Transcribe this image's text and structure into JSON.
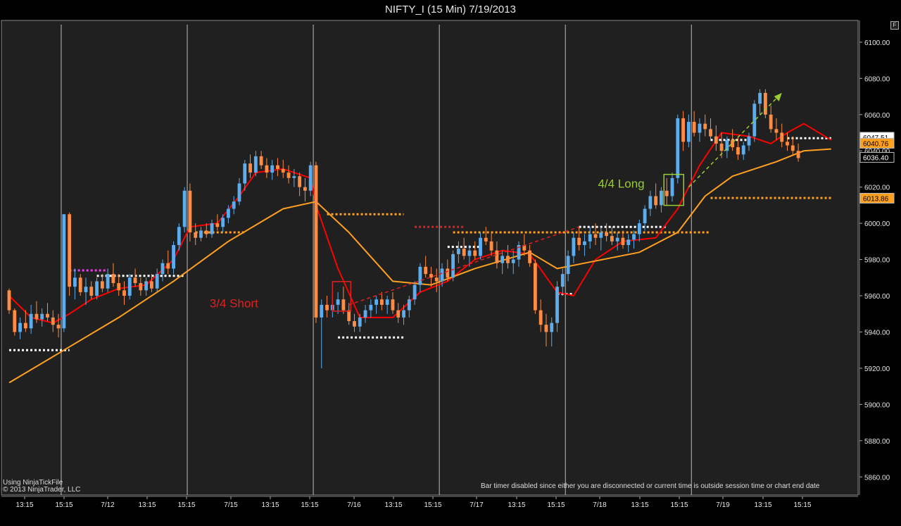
{
  "window": {
    "title": "NIFTY_I (15 Min)  7/19/2013",
    "float_button": "F"
  },
  "footer": {
    "provider": "Using NinjaTickFile",
    "copyright": "© 2013 NinjaTrader, LLC",
    "bar_timer_note": "Bar timer disabled since either you are disconnected or current time is outside session time or chart end date"
  },
  "chart_data": {
    "type": "candlestick",
    "title": "NIFTY_I (15 Min)  7/19/2013",
    "ylim": [
      5850,
      6112
    ],
    "y_ticks": [
      "6100.00",
      "6080.00",
      "6060.00",
      "6040.00",
      "6020.00",
      "6000.00",
      "5980.00",
      "5960.00",
      "5940.00",
      "5920.00",
      "5900.00",
      "5880.00",
      "5860.00"
    ],
    "y_tick_values": [
      6100,
      6080,
      6060,
      6040,
      6020,
      6000,
      5980,
      5960,
      5940,
      5920,
      5900,
      5880,
      5860
    ],
    "x_labels": [
      "13:15",
      "15:15",
      "7/12",
      "13:15",
      "15:15",
      "7/15",
      "13:15",
      "15:15",
      "7/16",
      "13:15",
      "15:15",
      "7/17",
      "13:15",
      "15:15",
      "7/18",
      "13:15",
      "15:15",
      "7/19",
      "13:15",
      "15:15"
    ],
    "bar_count": 150,
    "session_breaks": [
      10,
      33,
      56,
      79,
      102,
      125
    ],
    "candles": [
      [
        5963,
        5964,
        5950,
        5952
      ],
      [
        5952,
        5953,
        5938,
        5940
      ],
      [
        5940,
        5948,
        5936,
        5945
      ],
      [
        5945,
        5952,
        5940,
        5942
      ],
      [
        5942,
        5955,
        5939,
        5950
      ],
      [
        5950,
        5957,
        5945,
        5947
      ],
      [
        5947,
        5953,
        5943,
        5950
      ],
      [
        5950,
        5956,
        5946,
        5948
      ],
      [
        5948,
        5952,
        5940,
        5944
      ],
      [
        5944,
        5950,
        5937,
        5942
      ],
      [
        5942,
        6005,
        5940,
        6005
      ],
      [
        6005,
        6006,
        5960,
        5965
      ],
      [
        5965,
        5975,
        5958,
        5970
      ],
      [
        5970,
        5972,
        5960,
        5962
      ],
      [
        5962,
        5970,
        5955,
        5965
      ],
      [
        5965,
        5968,
        5958,
        5960
      ],
      [
        5960,
        5970,
        5958,
        5968
      ],
      [
        5968,
        5972,
        5962,
        5964
      ],
      [
        5964,
        5975,
        5962,
        5972
      ],
      [
        5972,
        5978,
        5965,
        5967
      ],
      [
        5967,
        5972,
        5960,
        5963
      ],
      [
        5963,
        5968,
        5955,
        5960
      ],
      [
        5960,
        5972,
        5958,
        5970
      ],
      [
        5970,
        5975,
        5965,
        5967
      ],
      [
        5967,
        5970,
        5960,
        5963
      ],
      [
        5963,
        5970,
        5960,
        5968
      ],
      [
        5968,
        5972,
        5962,
        5964
      ],
      [
        5964,
        5975,
        5962,
        5972
      ],
      [
        5972,
        5980,
        5968,
        5978
      ],
      [
        5978,
        5985,
        5972,
        5975
      ],
      [
        5975,
        5990,
        5972,
        5988
      ],
      [
        5988,
        6000,
        5985,
        5998
      ],
      [
        5998,
        6020,
        5995,
        6018
      ],
      [
        6018,
        6022,
        5990,
        5995
      ],
      [
        5995,
        6000,
        5988,
        5992
      ],
      [
        5992,
        5998,
        5990,
        5996
      ],
      [
        5996,
        6000,
        5992,
        5994
      ],
      [
        5994,
        6002,
        5992,
        6000
      ],
      [
        6000,
        6005,
        5996,
        5998
      ],
      [
        5998,
        6005,
        5995,
        6003
      ],
      [
        6003,
        6010,
        6000,
        6008
      ],
      [
        6008,
        6015,
        6005,
        6012
      ],
      [
        6012,
        6025,
        6010,
        6022
      ],
      [
        6022,
        6035,
        6018,
        6033
      ],
      [
        6033,
        6038,
        6025,
        6028
      ],
      [
        6028,
        6040,
        6026,
        6037
      ],
      [
        6037,
        6040,
        6030,
        6032
      ],
      [
        6032,
        6036,
        6025,
        6028
      ],
      [
        6028,
        6035,
        6024,
        6032
      ],
      [
        6032,
        6036,
        6026,
        6030
      ],
      [
        6030,
        6035,
        6025,
        6028
      ],
      [
        6028,
        6032,
        6022,
        6025
      ],
      [
        6025,
        6030,
        6020,
        6026
      ],
      [
        6026,
        6028,
        6015,
        6020
      ],
      [
        6020,
        6025,
        6012,
        6018
      ],
      [
        6018,
        6034,
        6015,
        6032
      ],
      [
        6032,
        6034,
        5945,
        5948
      ],
      [
        5948,
        5958,
        5920,
        5955
      ],
      [
        5955,
        5960,
        5948,
        5952
      ],
      [
        5952,
        5958,
        5948,
        5955
      ],
      [
        5955,
        5962,
        5950,
        5958
      ],
      [
        5958,
        5965,
        5950,
        5952
      ],
      [
        5952,
        5956,
        5944,
        5946
      ],
      [
        5946,
        5950,
        5940,
        5943
      ],
      [
        5943,
        5950,
        5940,
        5948
      ],
      [
        5948,
        5955,
        5945,
        5952
      ],
      [
        5952,
        5958,
        5948,
        5955
      ],
      [
        5955,
        5960,
        5950,
        5958
      ],
      [
        5958,
        5962,
        5952,
        5955
      ],
      [
        5955,
        5960,
        5950,
        5958
      ],
      [
        5958,
        5962,
        5950,
        5952
      ],
      [
        5952,
        5956,
        5945,
        5948
      ],
      [
        5948,
        5955,
        5944,
        5952
      ],
      [
        5952,
        5960,
        5948,
        5958
      ],
      [
        5958,
        5968,
        5955,
        5966
      ],
      [
        5966,
        5978,
        5962,
        5976
      ],
      [
        5976,
        5982,
        5970,
        5972
      ],
      [
        5972,
        5976,
        5965,
        5970
      ],
      [
        5970,
        5975,
        5962,
        5968
      ],
      [
        5968,
        5978,
        5965,
        5975
      ],
      [
        5975,
        5980,
        5968,
        5970
      ],
      [
        5970,
        5985,
        5968,
        5983
      ],
      [
        5983,
        5990,
        5978,
        5986
      ],
      [
        5986,
        5992,
        5980,
        5982
      ],
      [
        5982,
        5988,
        5976,
        5985
      ],
      [
        5985,
        5990,
        5980,
        5982
      ],
      [
        5982,
        5995,
        5980,
        5992
      ],
      [
        5992,
        5998,
        5988,
        5990
      ],
      [
        5990,
        5995,
        5982,
        5985
      ],
      [
        5985,
        5990,
        5975,
        5978
      ],
      [
        5978,
        5985,
        5972,
        5982
      ],
      [
        5982,
        5988,
        5975,
        5978
      ],
      [
        5978,
        5985,
        5972,
        5980
      ],
      [
        5980,
        5990,
        5976,
        5988
      ],
      [
        5988,
        5994,
        5982,
        5985
      ],
      [
        5985,
        5988,
        5976,
        5978
      ],
      [
        5978,
        5980,
        5950,
        5952
      ],
      [
        5952,
        5958,
        5940,
        5944
      ],
      [
        5944,
        5950,
        5932,
        5940
      ],
      [
        5940,
        5948,
        5932,
        5945
      ],
      [
        5945,
        5968,
        5940,
        5965
      ],
      [
        5965,
        5975,
        5960,
        5972
      ],
      [
        5972,
        5985,
        5968,
        5982
      ],
      [
        5982,
        5995,
        5978,
        5992
      ],
      [
        5992,
        5998,
        5985,
        5988
      ],
      [
        5988,
        5994,
        5982,
        5990
      ],
      [
        5990,
        5998,
        5986,
        5994
      ],
      [
        5994,
        6000,
        5988,
        5992
      ],
      [
        5992,
        5998,
        5985,
        5995
      ],
      [
        5995,
        6000,
        5990,
        5993
      ],
      [
        5993,
        5998,
        5988,
        5990
      ],
      [
        5990,
        5995,
        5985,
        5992
      ],
      [
        5992,
        5996,
        5986,
        5988
      ],
      [
        5988,
        5994,
        5984,
        5991
      ],
      [
        5991,
        5996,
        5986,
        5994
      ],
      [
        5994,
        6002,
        5990,
        6000
      ],
      [
        6000,
        6010,
        5996,
        6008
      ],
      [
        6008,
        6018,
        6004,
        6015
      ],
      [
        6015,
        6022,
        6008,
        6010
      ],
      [
        6010,
        6020,
        6006,
        6018
      ],
      [
        6018,
        6025,
        6010,
        6015
      ],
      [
        6015,
        6028,
        6012,
        6025
      ],
      [
        6025,
        6060,
        6022,
        6058
      ],
      [
        6058,
        6062,
        6040,
        6045
      ],
      [
        6045,
        6060,
        6042,
        6056
      ],
      [
        6056,
        6062,
        6048,
        6050
      ],
      [
        6050,
        6058,
        6045,
        6055
      ],
      [
        6055,
        6060,
        6048,
        6052
      ],
      [
        6052,
        6058,
        6046,
        6048
      ],
      [
        6048,
        6054,
        6040,
        6044
      ],
      [
        6044,
        6050,
        6036,
        6040
      ],
      [
        6040,
        6048,
        6036,
        6046
      ],
      [
        6046,
        6052,
        6040,
        6042
      ],
      [
        6042,
        6048,
        6035,
        6038
      ],
      [
        6038,
        6045,
        6035,
        6043
      ],
      [
        6043,
        6050,
        6040,
        6048
      ],
      [
        6048,
        6068,
        6045,
        6066
      ],
      [
        6066,
        6074,
        6060,
        6072
      ],
      [
        6072,
        6074,
        6058,
        6060
      ],
      [
        6060,
        6065,
        6050,
        6052
      ],
      [
        6052,
        6058,
        6046,
        6050
      ],
      [
        6050,
        6055,
        6042,
        6045
      ],
      [
        6045,
        6050,
        6040,
        6043
      ],
      [
        6043,
        6048,
        6038,
        6040
      ],
      [
        6040,
        6044,
        6034,
        6036
      ]
    ],
    "series": [
      {
        "name": "fast_ma",
        "color": "#ff0000",
        "values": [
          [
            0,
            5960
          ],
          [
            4,
            5948
          ],
          [
            8,
            5945
          ],
          [
            11,
            5950
          ],
          [
            15,
            5958
          ],
          [
            20,
            5964
          ],
          [
            25,
            5966
          ],
          [
            30,
            5980
          ],
          [
            33,
            5998
          ],
          [
            38,
            6000
          ],
          [
            42,
            6015
          ],
          [
            45,
            6028
          ],
          [
            50,
            6030
          ],
          [
            55,
            6025
          ],
          [
            56,
            6010
          ],
          [
            60,
            5975
          ],
          [
            64,
            5948
          ],
          [
            70,
            5948
          ],
          [
            75,
            5962
          ],
          [
            80,
            5968
          ],
          [
            85,
            5980
          ],
          [
            90,
            5985
          ],
          [
            95,
            5983
          ],
          [
            100,
            5962
          ],
          [
            103,
            5960
          ],
          [
            107,
            5980
          ],
          [
            112,
            5990
          ],
          [
            118,
            5992
          ],
          [
            122,
            6008
          ],
          [
            126,
            6032
          ],
          [
            130,
            6050
          ],
          [
            135,
            6048
          ],
          [
            139,
            6044
          ],
          [
            142,
            6050
          ],
          [
            145,
            6055
          ],
          [
            150,
            6046
          ]
        ]
      },
      {
        "name": "slow_ma",
        "color": "#ffa020",
        "values": [
          [
            0,
            5912
          ],
          [
            10,
            5930
          ],
          [
            20,
            5948
          ],
          [
            30,
            5968
          ],
          [
            40,
            5990
          ],
          [
            50,
            6008
          ],
          [
            56,
            6012
          ],
          [
            62,
            5995
          ],
          [
            70,
            5968
          ],
          [
            77,
            5966
          ],
          [
            85,
            5975
          ],
          [
            95,
            5984
          ],
          [
            100,
            5975
          ],
          [
            105,
            5978
          ],
          [
            115,
            5984
          ],
          [
            122,
            5995
          ],
          [
            127,
            6015
          ],
          [
            132,
            6026
          ],
          [
            140,
            6034
          ],
          [
            145,
            6040
          ],
          [
            150,
            6041
          ]
        ]
      }
    ],
    "level_dashes": [
      {
        "color": "#ffffff",
        "y": 5930,
        "from": 0,
        "to": 11
      },
      {
        "color": "#ffffff",
        "y": 5971,
        "from": 16,
        "to": 32
      },
      {
        "color": "#ff33ff",
        "y": 5974,
        "from": 11,
        "to": 18
      },
      {
        "color": "#ffa020",
        "y": 5995,
        "from": 34,
        "to": 43
      },
      {
        "color": "#ffa020",
        "y": 6005,
        "from": 58,
        "to": 72
      },
      {
        "color": "#ffffff",
        "y": 5937,
        "from": 60,
        "to": 72
      },
      {
        "color": "#e02020",
        "y": 5998,
        "from": 74,
        "to": 83
      },
      {
        "color": "#ffa020",
        "y": 5995,
        "from": 81,
        "to": 128
      },
      {
        "color": "#ffffff",
        "y": 5987,
        "from": 80,
        "to": 86
      },
      {
        "color": "#ffffff",
        "y": 5998,
        "from": 104,
        "to": 120
      },
      {
        "color": "#ffffff",
        "y": 5961,
        "from": 100,
        "to": 103
      },
      {
        "color": "#ffffff",
        "y": 6046,
        "from": 128,
        "to": 135
      },
      {
        "color": "#ffa020",
        "y": 6014,
        "from": 128,
        "to": 150
      },
      {
        "color": "#ffffff",
        "y": 6047,
        "from": 142,
        "to": 150
      }
    ],
    "annotations": [
      {
        "text": "3/4 Short",
        "color": "#e02020",
        "x": 52,
        "y": 5956
      },
      {
        "text": "4/4 Long",
        "color": "#9acd32",
        "x": 119,
        "y": 6022
      }
    ],
    "price_markers": [
      {
        "label": "6047.51",
        "value": 6047.51,
        "bg": "#ffffff",
        "fg": "#000000"
      },
      {
        "label": "6040.76",
        "value": 6044.2,
        "bg": "#ffa020",
        "fg": "#000000"
      },
      {
        "label": "6036.40",
        "value": 6036.4,
        "bg": "#000000",
        "fg": "#ffffff"
      },
      {
        "label": "6013.86",
        "value": 6013.86,
        "bg": "#ffa020",
        "fg": "#000000"
      }
    ]
  }
}
